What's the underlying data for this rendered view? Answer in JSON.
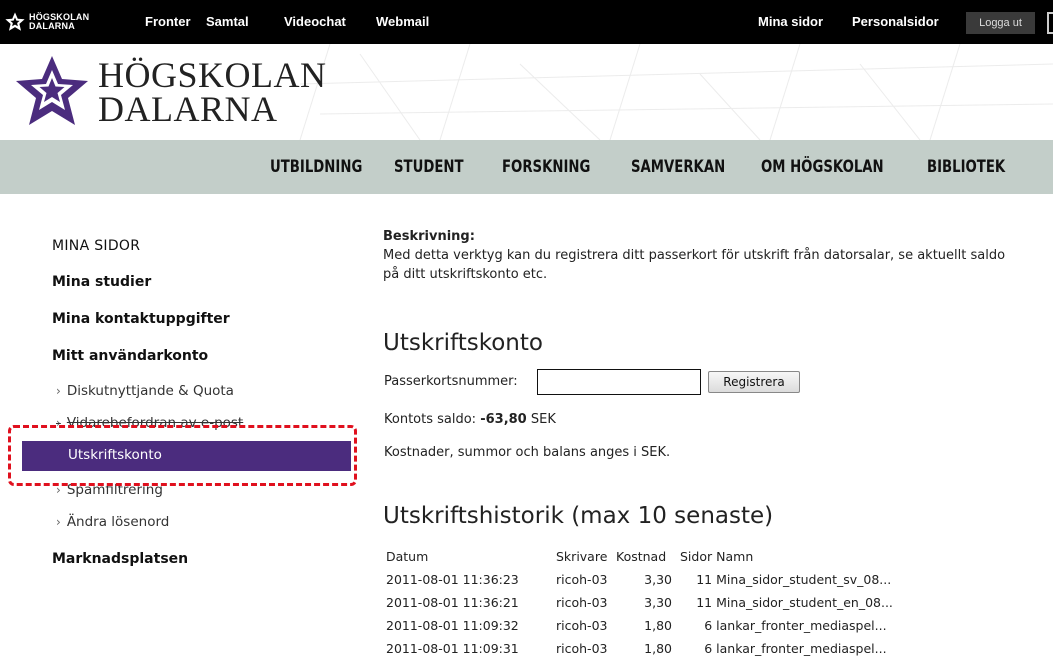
{
  "topbar": {
    "logo_text_line1": "HÖGSKOLAN",
    "logo_text_line2": "DALARNA",
    "links": [
      "Fronter",
      "Samtal",
      "Videochat",
      "Webmail"
    ],
    "right_links": [
      "Mina sidor",
      "Personalsidor"
    ],
    "logout_label": "Logga ut"
  },
  "header": {
    "brand_line1": "HÖGSKOLAN",
    "brand_line2": "DALARNA"
  },
  "mainnav": {
    "items": [
      "UTBILDNING",
      "STUDENT",
      "FORSKNING",
      "SAMVERKAN",
      "OM HÖGSKOLAN",
      "BIBLIOTEK"
    ]
  },
  "sidebar": {
    "heading": "MINA SIDOR",
    "items": [
      {
        "label": "Mina studier"
      },
      {
        "label": "Mina kontaktuppgifter"
      },
      {
        "label": "Mitt användarkonto"
      },
      {
        "label": "Diskutnyttjande & Quota"
      },
      {
        "label": "Vidarebefordran av e-post"
      },
      {
        "label": "Utskriftskonto"
      },
      {
        "label": "Spamfiltrering"
      },
      {
        "label": "Ändra lösenord"
      },
      {
        "label": "Marknadsplatsen"
      }
    ]
  },
  "content": {
    "desc_label": "Beskrivning:",
    "desc_text": "Med detta verktyg kan du registrera ditt passerkort för utskrift från datorsalar, se aktuellt saldo på ditt utskriftskonto etc.",
    "account_title": "Utskriftskonto",
    "card_label": "Passerkortsnummer:",
    "card_value": "",
    "register_label": "Registrera",
    "balance_prefix": "Kontots saldo: ",
    "balance_value": "-63,80",
    "balance_suffix": " SEK",
    "currency_note": "Kostnader, summor och balans anges i SEK.",
    "history_title": "Utskriftshistorik (max 10 senaste)"
  },
  "history": {
    "columns": [
      "Datum",
      "Skrivare",
      "Kostnad",
      "Sidor",
      "Namn"
    ],
    "rows": [
      [
        "2011-08-01 11:36:23",
        "ricoh-03",
        "3,30",
        "11",
        "Mina_sidor_student_sv_08..."
      ],
      [
        "2011-08-01 11:36:21",
        "ricoh-03",
        "3,30",
        "11",
        "Mina_sidor_student_en_08..."
      ],
      [
        "2011-08-01 11:09:32",
        "ricoh-03",
        "1,80",
        "6",
        "lankar_fronter_mediaspel..."
      ],
      [
        "2011-08-01 11:09:31",
        "ricoh-03",
        "1,80",
        "6",
        "lankar_fronter_mediaspel..."
      ]
    ]
  },
  "colors": {
    "brand_purple": "#4b2c7e",
    "nav_bg": "#c3cec9",
    "callout_red": "#e0101e",
    "topbar_bg": "#000000"
  }
}
